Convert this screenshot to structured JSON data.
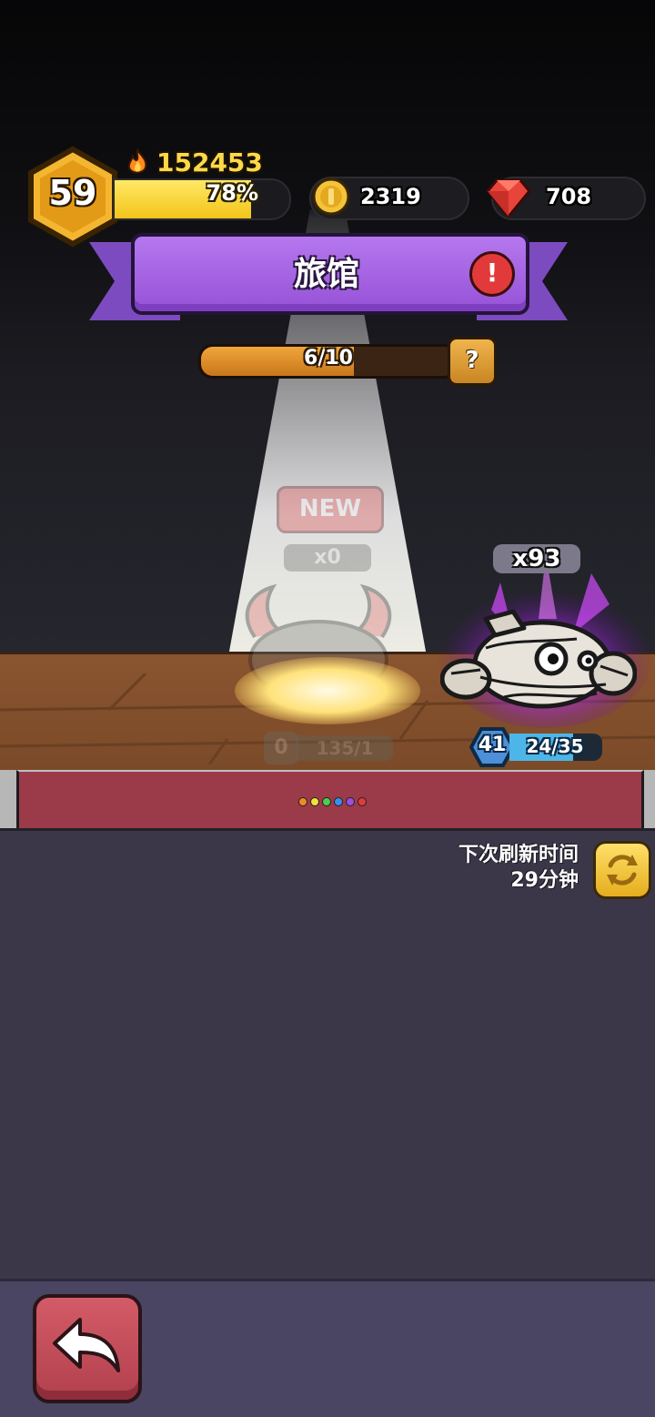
{
  "player": {
    "level": "59",
    "power": "152453",
    "xp_percent_label": "78%",
    "xp_fraction": 0.78
  },
  "currencies": {
    "coins": "2319",
    "gems": "708"
  },
  "banner": {
    "title": "旅馆",
    "alert": "!"
  },
  "capacity": {
    "label": "6/10",
    "fraction": 0.6,
    "help": "?"
  },
  "slot_locked": {
    "badge": "NEW",
    "count": "x0",
    "level": "0",
    "progress": "135/1"
  },
  "monster": {
    "count": "x93",
    "level": "41",
    "progress": "24/35",
    "progress_fraction": 0.686
  },
  "page_dots": {
    "colors": [
      "#f08a2a",
      "#f1e23a",
      "#4bd04b",
      "#3a8ef0",
      "#9b4ee0",
      "#e23a3a"
    ]
  },
  "refresh": {
    "line1": "下次刷新时间",
    "line2": "29分钟"
  },
  "colors": {
    "banner_purple": "#9652d7",
    "gold": "#ffd84a",
    "back_button": "#c24a57"
  }
}
